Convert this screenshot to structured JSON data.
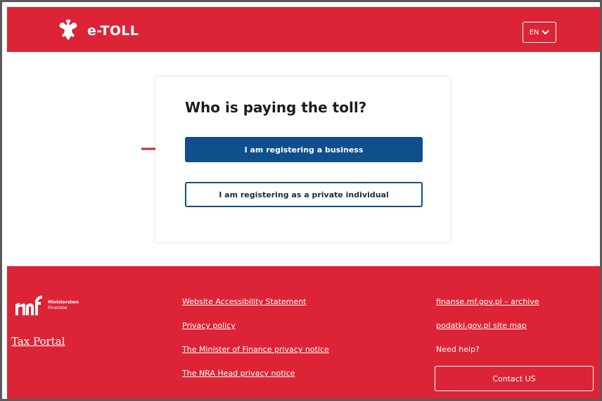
{
  "header": {
    "brand": "e-TOLL",
    "lang_label": "EN"
  },
  "card": {
    "title": "Who is paying the toll?",
    "business_label": "I am registering a business",
    "private_label": "I am registering as a private individual"
  },
  "footer": {
    "ministry_line1": "Ministerstwo",
    "ministry_line2": "Finansów",
    "tax_portal": "Tax Portal",
    "links_mid": [
      "Website Accessibility Statement",
      "Privacy policy",
      "The Minister of Finance privacy notice",
      "The NRA Head privacy notice"
    ],
    "links_right": [
      "finanse.mf.gov.pl – archive",
      "podatki.gov.pl site map"
    ],
    "need_help": "Need help?",
    "contact_label": "Contact US"
  },
  "colors": {
    "brand_red": "#dc2436",
    "primary_blue": "#0f4f8c",
    "arrow_red": "#d9232f"
  },
  "icons": [
    "eagle-icon",
    "chevron-down-icon",
    "arrow-right-icon",
    "mf-logo-icon"
  ]
}
